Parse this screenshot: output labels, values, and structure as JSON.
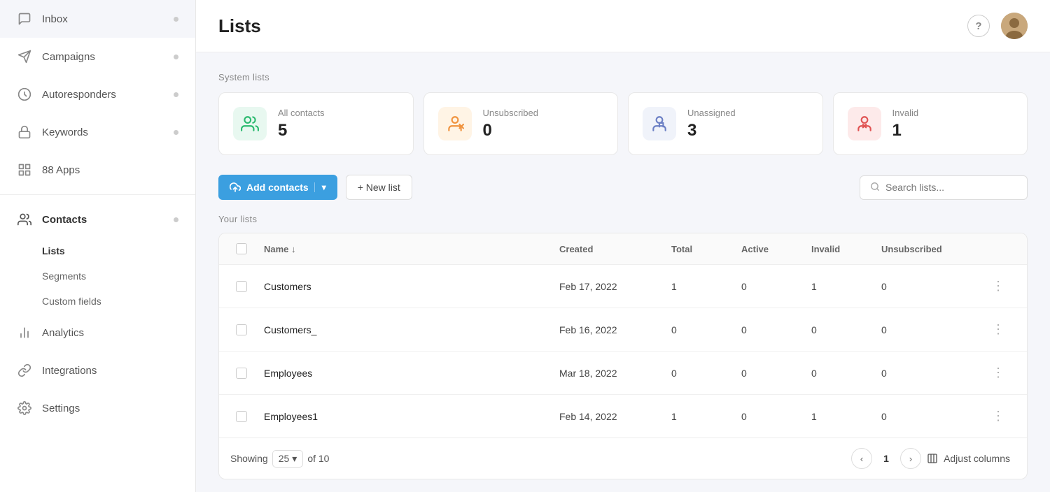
{
  "sidebar": {
    "items": [
      {
        "id": "inbox",
        "label": "Inbox",
        "icon": "💬",
        "dot": true
      },
      {
        "id": "campaigns",
        "label": "Campaigns",
        "icon": "📣",
        "dot": true
      },
      {
        "id": "autoresponders",
        "label": "Autoresponders",
        "icon": "🔑",
        "dot": true
      },
      {
        "id": "keywords",
        "label": "Keywords",
        "icon": "🔍",
        "dot": true
      },
      {
        "id": "apps",
        "label": "88 Apps",
        "icon": "⊞",
        "dot": false
      },
      {
        "id": "contacts",
        "label": "Contacts",
        "icon": "👥",
        "dot": true,
        "active": true
      },
      {
        "id": "analytics",
        "label": "Analytics",
        "icon": "📊",
        "dot": false
      },
      {
        "id": "integrations",
        "label": "Integrations",
        "icon": "🔗",
        "dot": false
      },
      {
        "id": "settings",
        "label": "Settings",
        "icon": "⚙️",
        "dot": false
      }
    ],
    "sub_items": [
      {
        "id": "lists",
        "label": "Lists",
        "active": true
      },
      {
        "id": "segments",
        "label": "Segments",
        "active": false
      },
      {
        "id": "custom-fields",
        "label": "Custom fields",
        "active": false
      }
    ]
  },
  "page": {
    "title": "Lists"
  },
  "system_lists": {
    "label": "System lists",
    "cards": [
      {
        "id": "all-contacts",
        "label": "All contacts",
        "value": "5",
        "icon_type": "green"
      },
      {
        "id": "unsubscribed",
        "label": "Unsubscribed",
        "value": "0",
        "icon_type": "orange"
      },
      {
        "id": "unassigned",
        "label": "Unassigned",
        "value": "3",
        "icon_type": "gray"
      },
      {
        "id": "invalid",
        "label": "Invalid",
        "value": "1",
        "icon_type": "red"
      }
    ]
  },
  "toolbar": {
    "add_contacts_label": "Add contacts",
    "new_list_label": "+ New list",
    "search_placeholder": "Search lists..."
  },
  "your_lists": {
    "label": "Your lists",
    "columns": [
      {
        "id": "name",
        "label": "Name ↓"
      },
      {
        "id": "created",
        "label": "Created"
      },
      {
        "id": "total",
        "label": "Total"
      },
      {
        "id": "active",
        "label": "Active"
      },
      {
        "id": "invalid",
        "label": "Invalid"
      },
      {
        "id": "unsubscribed",
        "label": "Unsubscribed"
      }
    ],
    "rows": [
      {
        "id": 1,
        "name": "Customers",
        "created": "Feb 17, 2022",
        "total": "1",
        "active": "0",
        "invalid": "1",
        "unsubscribed": "0"
      },
      {
        "id": 2,
        "name": "Customers_",
        "created": "Feb 16, 2022",
        "total": "0",
        "active": "0",
        "invalid": "0",
        "unsubscribed": "0"
      },
      {
        "id": 3,
        "name": "Employees",
        "created": "Mar 18, 2022",
        "total": "0",
        "active": "0",
        "invalid": "0",
        "unsubscribed": "0"
      },
      {
        "id": 4,
        "name": "Employees1",
        "created": "Feb 14, 2022",
        "total": "1",
        "active": "0",
        "invalid": "1",
        "unsubscribed": "0"
      }
    ]
  },
  "footer": {
    "showing_label": "Showing",
    "per_page": "25",
    "of_label": "of 10",
    "page_num": "1",
    "adjust_columns_label": "Adjust columns"
  }
}
